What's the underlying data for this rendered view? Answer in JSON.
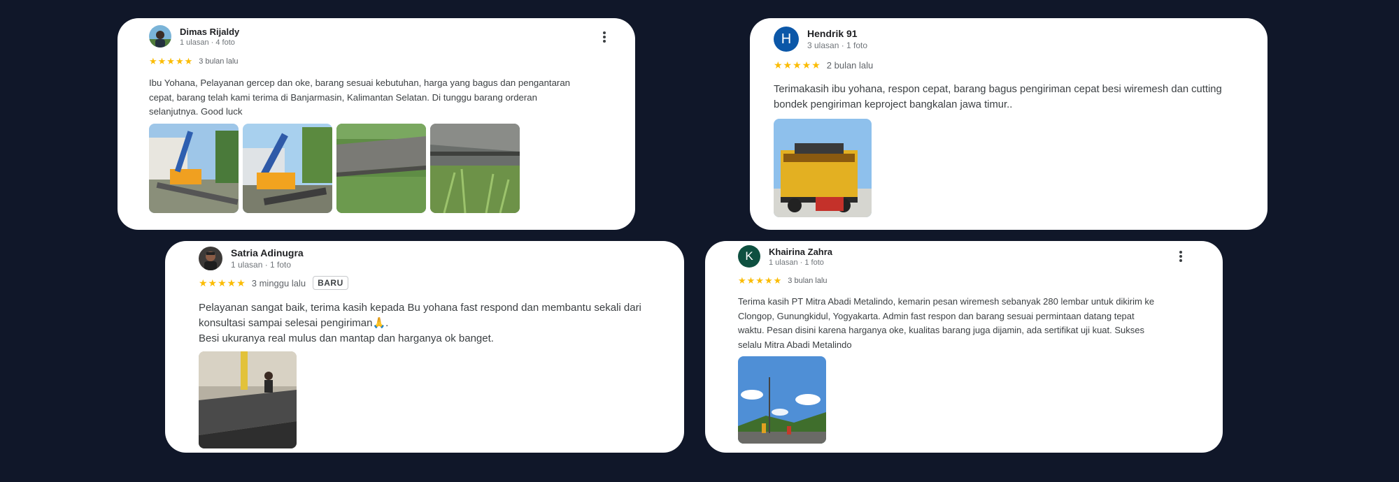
{
  "reviews": [
    {
      "author": "Dimas Rijaldy",
      "meta": "1 ulasan · 4 foto",
      "stars": "★★★★★",
      "when": "3 bulan lalu",
      "text_lines": [
        "Ibu Yohana, Pelayanan gercep dan oke, barang sesuai kebutuhan, harga yang bagus dan pengantaran",
        "cepat, barang telah kami terima di Banjarmasin, Kalimantan Selatan. Di tunggu barang orderan",
        "selanjutnya. Good luck"
      ],
      "photo_count": 4
    },
    {
      "author": "Hendrik 91",
      "meta": "3 ulasan · 1 foto",
      "avatar_letter": "H",
      "stars": "★★★★★",
      "when": "2 bulan lalu",
      "text_lines": [
        "Terimakasih ibu yohana, respon cepat, barang bagus pengiriman cepat besi wiremesh dan cutting",
        "bondek pengiriman keproject bangkalan jawa timur.."
      ],
      "photo_count": 1
    },
    {
      "author": "Satria Adinugra",
      "meta": "1 ulasan · 1 foto",
      "stars": "★★★★★",
      "when": "3 minggu lalu",
      "badge": "BARU",
      "text_lines": [
        "Pelayanan sangat baik, terima kasih kepada Bu yohana fast respond dan membantu sekali dari",
        "konsultasi sampai selesai pengiriman🙏.",
        "Besi ukuranya real mulus dan mantap dan harganya ok banget."
      ],
      "photo_count": 1
    },
    {
      "author": "Khairina Zahra",
      "meta": "1 ulasan · 1 foto",
      "avatar_letter": "K",
      "stars": "★★★★★",
      "when": "3 bulan lalu",
      "text_lines": [
        "Terima kasih PT Mitra Abadi Metalindo, kemarin pesan wiremesh sebanyak 280 lembar untuk dikirim ke",
        "Clongop, Gunungkidul, Yogyakarta. Admin fast respon dan barang sesuai permintaan datang tepat",
        "waktu. Pesan disini karena harganya oke, kualitas barang juga dijamin, ada sertifikat uji kuat. Sukses",
        "selalu Mitra Abadi Metalindo"
      ],
      "photo_count": 1
    }
  ],
  "colors": {
    "background": "#101729",
    "star": "#fbbc04",
    "avatar_h": "#0b57a8",
    "avatar_k": "#0e5040"
  },
  "icons": {
    "menu": "more-vert-icon",
    "star": "star-icon"
  }
}
